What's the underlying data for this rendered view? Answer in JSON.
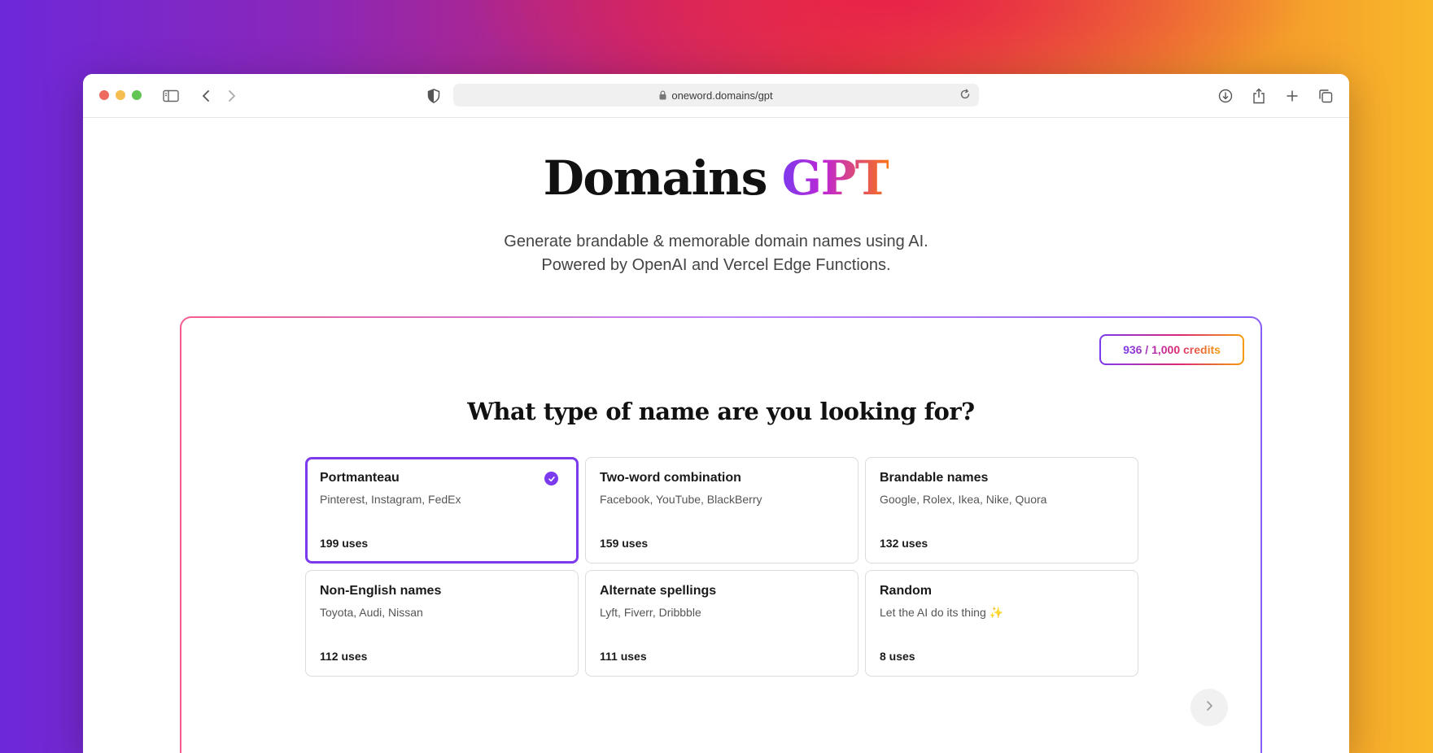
{
  "browser": {
    "url": "oneword.domains/gpt",
    "icons": [
      "sidebar-icon",
      "back-icon",
      "forward-icon",
      "shield-icon",
      "lock-icon",
      "reload-icon",
      "download-icon",
      "share-icon",
      "new-tab-icon",
      "tabs-overview-icon"
    ]
  },
  "hero": {
    "title_main": "Domains",
    "title_accent": "GPT",
    "subtitle_line1": "Generate brandable & memorable domain names using AI.",
    "subtitle_line2": "Powered by OpenAI and Vercel Edge Functions."
  },
  "card": {
    "credits": "936 / 1,000 credits",
    "question": "What type of name are you looking for?",
    "options": [
      {
        "name": "Portmanteau",
        "examples": "Pinterest, Instagram, FedEx",
        "uses": "199 uses"
      },
      {
        "name": "Two-word combination",
        "examples": "Facebook, YouTube, BlackBerry",
        "uses": "159 uses"
      },
      {
        "name": "Brandable names",
        "examples": "Google, Rolex, Ikea, Nike, Quora",
        "uses": "132 uses"
      },
      {
        "name": "Non-English names",
        "examples": "Toyota, Audi, Nissan",
        "uses": "112 uses"
      },
      {
        "name": "Alternate spellings",
        "examples": "Lyft, Fiverr, Dribbble",
        "uses": "111 uses"
      },
      {
        "name": "Random",
        "examples": "Let the AI do its thing ✨",
        "uses": "8 uses"
      }
    ],
    "selected_option": "Portmanteau"
  },
  "colors": {
    "accent": "#7c3aed",
    "gradient_start": "#7c3aed",
    "gradient_mid": "#db2777",
    "gradient_end": "#f59e0b"
  }
}
